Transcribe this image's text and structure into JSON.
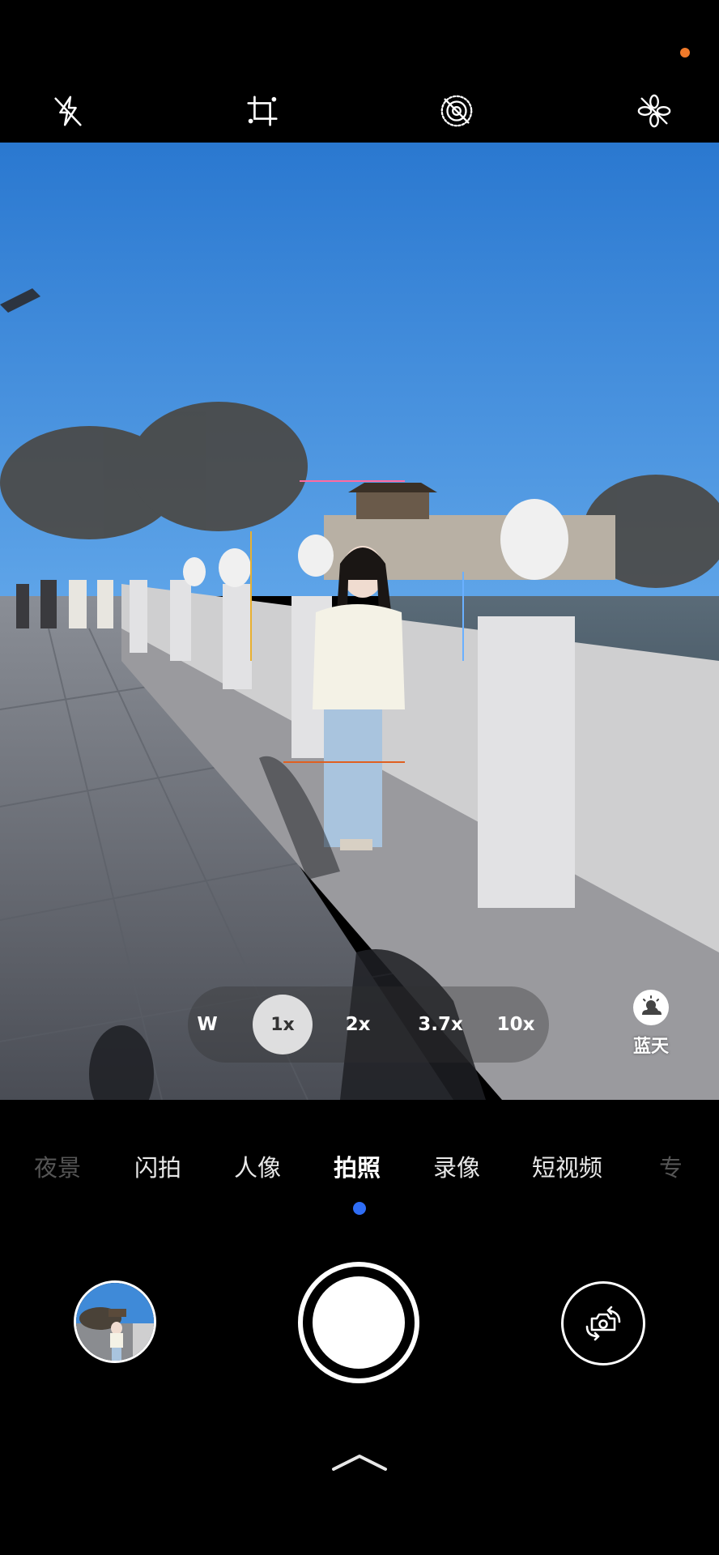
{
  "toolbar": {
    "icons": [
      "flash-off-icon",
      "crop-frame-icon",
      "live-photo-off-icon",
      "filter-icon"
    ]
  },
  "zoom": {
    "options": [
      {
        "label": "W",
        "selected": false
      },
      {
        "label": "1x",
        "selected": true
      },
      {
        "label": "2x",
        "selected": false
      },
      {
        "label": "3.7x",
        "selected": false
      },
      {
        "label": "10x",
        "selected": false
      }
    ]
  },
  "scene": {
    "label": "蓝天",
    "icon": "sun-cloud-icon"
  },
  "modes": {
    "items": [
      "夜景",
      "闪拍",
      "人像",
      "拍照",
      "录像",
      "短视频",
      "专"
    ],
    "selected": "拍照"
  },
  "colors": {
    "background": "#000000",
    "accent_dot": "#2f6df5",
    "recording_dot": "#f07a2a",
    "sky": "#2f7fd4"
  }
}
